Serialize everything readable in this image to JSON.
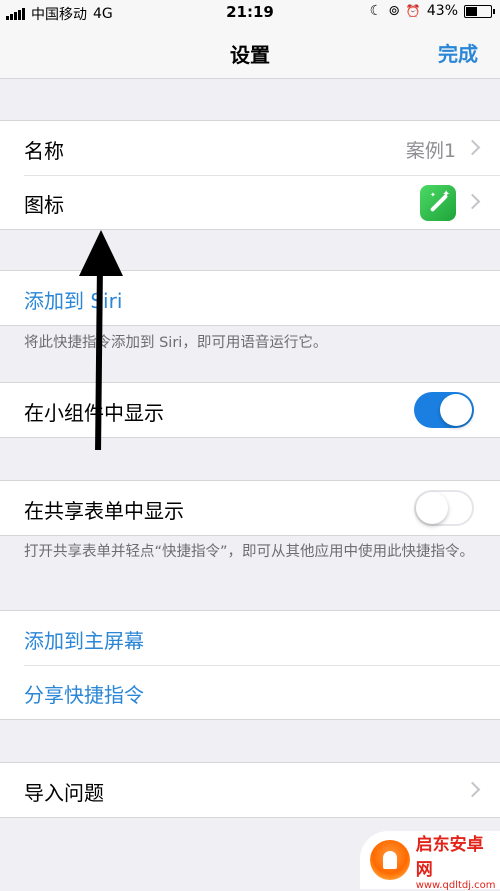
{
  "status_bar": {
    "carrier": "中国移动",
    "network": "4G",
    "time": "21:19",
    "moon_glyph": "☾",
    "lock_glyph": "⊚",
    "alarm_glyph": "⏰",
    "battery_percent": "43%",
    "battery_level": 0.43
  },
  "nav": {
    "title": "设置",
    "done_label": "完成"
  },
  "section1": {
    "name_label": "名称",
    "name_value": "案例1",
    "icon_label": "图标"
  },
  "section2": {
    "add_siri_label": "添加到 Siri",
    "add_siri_note": "将此快捷指令添加到 Siri，即可用语音运行它。"
  },
  "section3": {
    "widget_label": "在小组件中显示",
    "widget_on": true
  },
  "section4": {
    "share_label": "在共享表单中显示",
    "share_on": false,
    "share_note": "打开共享表单并轻点“快捷指令”，即可从其他应用中使用此快捷指令。"
  },
  "section5": {
    "home_screen_label": "添加到主屏幕",
    "share_shortcut_label": "分享快捷指令"
  },
  "section6": {
    "import_label": "导入问题"
  },
  "watermark": {
    "name": "启东安卓网",
    "url": "www.qdltdj.com"
  },
  "colors": {
    "accent": "#2a86d6",
    "toggle_on": "#1a7fe0",
    "background": "#efeff4"
  }
}
